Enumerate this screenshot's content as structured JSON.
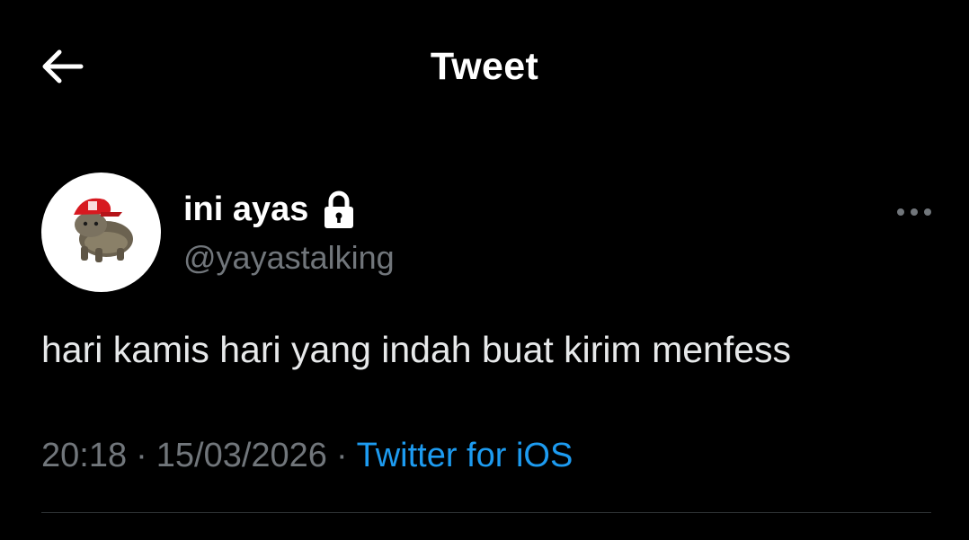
{
  "header": {
    "title": "Tweet",
    "back_icon": "arrow-left-icon"
  },
  "tweet": {
    "author": {
      "display_name": "ini ayas",
      "handle": "@yayastalking",
      "protected_icon": "lock-icon",
      "avatar": "cat-with-red-cap-avatar"
    },
    "text": "hari kamis hari yang indah buat kirim menfess",
    "time": "20:18",
    "separator": "·",
    "date": "15/03/2026",
    "source": "Twitter for iOS",
    "more_icon": "more-horizontal-icon"
  },
  "colors": {
    "background": "#000000",
    "text_primary": "#e7e9ea",
    "text_secondary": "#71767b",
    "link": "#1d9bf0",
    "divider": "#2f3336"
  }
}
